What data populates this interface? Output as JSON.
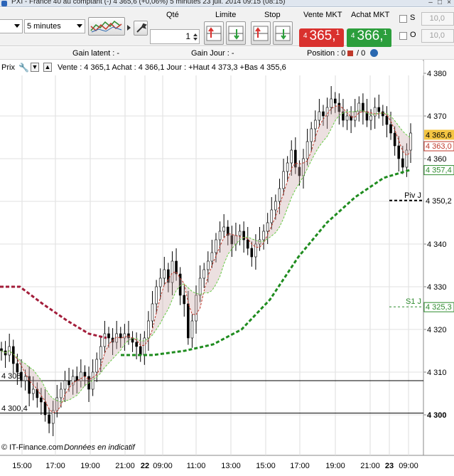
{
  "window": {
    "title": "PXI - France 40 au comptant (-)    4 365,6 (+0,06%)    5 minutes  23 juil. 2014 09:15 (08:15)"
  },
  "toolbar": {
    "interval": "5 minutes",
    "qty_label": "Qté",
    "qty_value": "1",
    "limit_label": "Limite",
    "stop_label": "Stop",
    "sell_label": "Vente MKT",
    "buy_label": "Achat MKT",
    "sell_prefix": "4",
    "sell_price": "365,",
    "sell_suffix": "1",
    "buy_prefix": "4",
    "buy_price": "366,",
    "buy_suffix": "1",
    "s_label": "S",
    "o_label": "O",
    "s_value": "10,0",
    "o_value": "10,0",
    "colors": {
      "sell": "#d9312e",
      "buy": "#2c9e3c"
    }
  },
  "gainbar": {
    "gain_latent": "Gain latent : -",
    "gain_jour": "Gain Jour : -",
    "position": "Position : 0",
    "slash": "/ 0"
  },
  "chart_header": {
    "label": "Prix",
    "quote_text": "Vente : 4 365,1 Achat : 4 366,1  Jour : +Haut 4 373,3 +Bas 4 355,6"
  },
  "footer": {
    "source": "© IT-Finance.com",
    "note": "Données en indicatif"
  },
  "chart_data": {
    "type": "candlestick",
    "title": "",
    "ylim": [
      4295,
      4383
    ],
    "y_ticks": [
      4300,
      4310,
      4320,
      4330,
      4340,
      4350,
      4360,
      4370,
      4380
    ],
    "y_tick_labels": [
      "4 300",
      "4 310",
      "4 320",
      "4 330",
      "4 340",
      "4 350",
      "4 360",
      "4 370",
      "4 380"
    ],
    "x_tick_labels": [
      "15:00",
      "17:00",
      "19:00",
      "21:00",
      "22",
      "09:00",
      "11:00",
      "13:00",
      "15:00",
      "17:00",
      "19:00",
      "21:00",
      "23",
      "09:00"
    ],
    "current_price": {
      "label": "4 365,6",
      "value": 4365.6,
      "color": "#f4c542"
    },
    "price_tags": [
      {
        "label": "4 363,0",
        "value": 4363.0,
        "color": "#c0392b"
      },
      {
        "label": "4 357,4",
        "value": 4357.4,
        "color": "#2e8b2e"
      },
      {
        "label": "4 350,2",
        "value": 4350.2,
        "color": "#000000"
      },
      {
        "label": "4 325,3",
        "value": 4325.3,
        "color": "#2e8b2e"
      }
    ],
    "pivot_lines": [
      {
        "name": "Piv J",
        "value": 4350.2,
        "color": "#000000"
      },
      {
        "name": "S1 J",
        "value": 4325.3,
        "color": "#2e8b2e"
      }
    ],
    "horizontal_lines": [
      {
        "label": "4 308",
        "value": 4308.0
      },
      {
        "label": "4 300,4",
        "value": 4300.4
      }
    ],
    "close_series": [
      4315,
      4314,
      4316,
      4312,
      4310,
      4308,
      4309,
      4305,
      4306,
      4304,
      4303,
      4300,
      4298,
      4301,
      4304,
      4306,
      4308,
      4307,
      4309,
      4308,
      4310,
      4309,
      4306,
      4310,
      4313,
      4316,
      4319,
      4318,
      4317,
      4319,
      4318,
      4319,
      4318,
      4317,
      4316,
      4314,
      4318,
      4322,
      4326,
      4330,
      4332,
      4334,
      4331,
      4336,
      4333,
      4328,
      4326,
      4318,
      4322,
      4328,
      4332,
      4334,
      4336,
      4338,
      4341,
      4343,
      4344,
      4342,
      4340,
      4342,
      4343,
      4341,
      4339,
      4337,
      4340,
      4341,
      4343,
      4345,
      4348,
      4350,
      4353,
      4357,
      4359,
      4362,
      4358,
      4356,
      4360,
      4364,
      4367,
      4369,
      4371,
      4370,
      4372,
      4374,
      4373,
      4371,
      4369,
      4370,
      4369,
      4371,
      4373,
      4371,
      4369,
      4370,
      4372,
      4371,
      4370,
      4368,
      4366,
      4363,
      4360,
      4358,
      4362,
      4366
    ]
  }
}
